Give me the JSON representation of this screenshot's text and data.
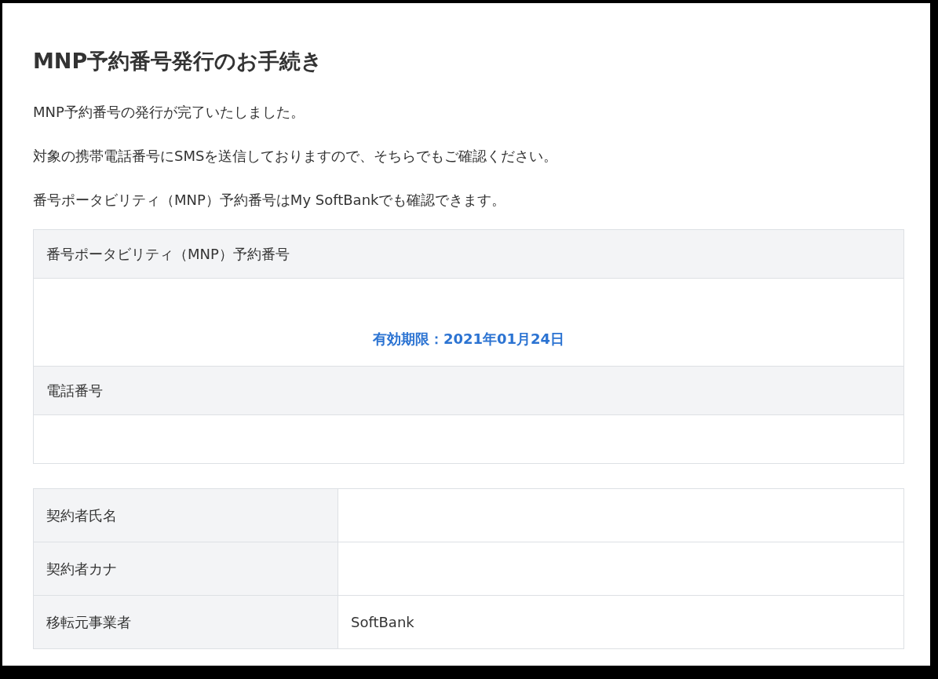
{
  "title": "MNP予約番号発行のお手続き",
  "paragraphs": [
    "MNP予約番号の発行が完了いたしました。",
    "対象の携帯電話番号にSMSを送信しておりますので、そちらでもご確認ください。",
    "番号ポータビリティ（MNP）予約番号はMy SoftBankでも確認できます。"
  ],
  "result_table": [
    {
      "heading": "番号ポータビリティ（MNP）予約番号",
      "note": "有効期限：2021年01月24日"
    },
    {
      "heading": "電話番号"
    }
  ],
  "details_table": [
    {
      "label": "契約者氏名"
    },
    {
      "label": "契約者カナ"
    },
    {
      "label": "移転元事業者",
      "value": "SoftBank"
    }
  ]
}
